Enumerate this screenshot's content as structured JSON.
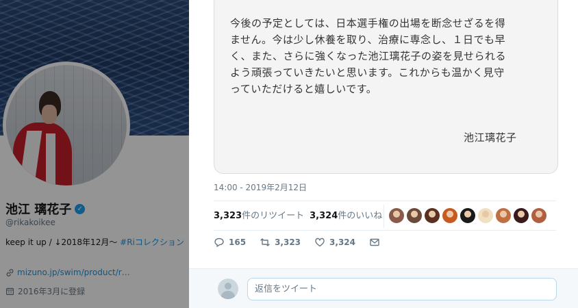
{
  "profile": {
    "name": "池江 璃花子",
    "handle": "@rikakoikee",
    "bio_text": "keep it up / ↓2018年12月〜 ",
    "bio_hashtag": "#Riコレクション",
    "link": "mizuno.jp/swim/product/r…",
    "joined": "2016年3月に登録"
  },
  "tweet": {
    "letter_lines": [
      "今後の予定としては、日本選手権の出場を断念せざるを得",
      "ません。今は少し休養を取り、治療に専念し、１日でも早",
      "く、また、さらに強くなった池江璃花子の姿を見せられる",
      "よう頑張っていきたいと思います。これからも温かく見守",
      "っていただけると嬉しいです。"
    ],
    "signature": "池江璃花子",
    "timestamp": "14:00 - 2019年2月12日",
    "retweet_count": "3,323",
    "retweet_label": "件のリツイート",
    "like_count": "3,324",
    "like_label": "件のいいね",
    "liker_colors": [
      "#8a5a4a",
      "#6b4a3a",
      "#5a3020",
      "#c85a20",
      "#1a1a1a",
      "#f0e0c0",
      "#c07040",
      "#3a1a1a",
      "#b06040"
    ]
  },
  "actions": {
    "reply_count": "165",
    "retweet_count": "3,323",
    "like_count": "3,324"
  },
  "reply": {
    "placeholder": "返信をツイート"
  }
}
